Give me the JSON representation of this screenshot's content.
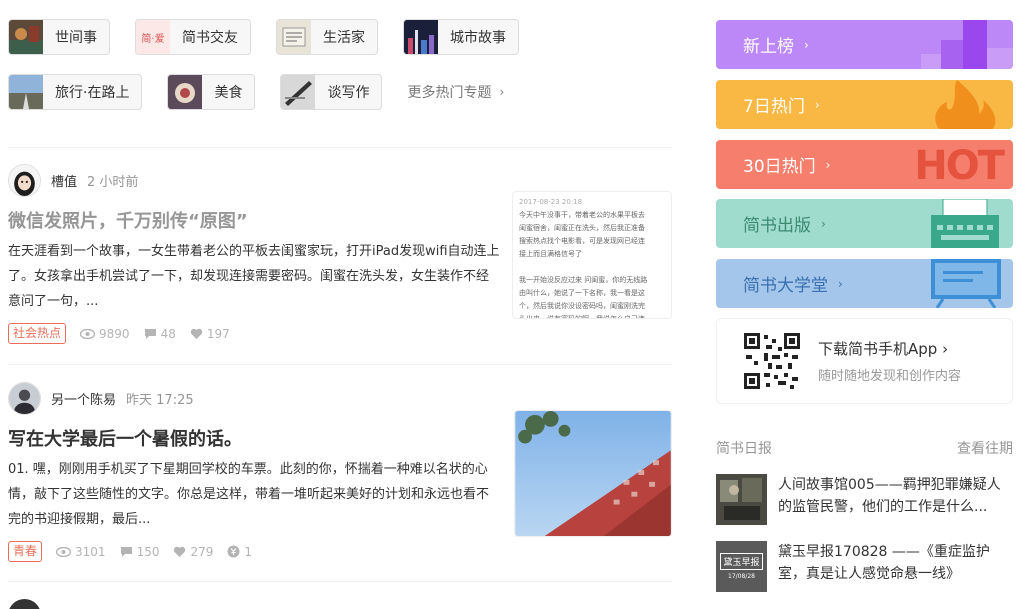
{
  "topics": {
    "row1": [
      {
        "label": "世间事"
      },
      {
        "label": "简书交友",
        "thumb_text": "简·爱"
      },
      {
        "label": "生活家"
      },
      {
        "label": "城市故事"
      }
    ],
    "row2": [
      {
        "label": "旅行·在路上"
      },
      {
        "label": "美食"
      },
      {
        "label": "谈写作"
      }
    ],
    "more_label": "更多热门专题"
  },
  "articles": [
    {
      "author": "槽值",
      "time": "2 小时前",
      "title": "微信发照片，千万别传“原图”",
      "abstract": "在天涯看到一个故事，一女生带着老公的平板去闺蜜家玩，打开iPad发现wifi自动连上了。女孩拿出手机尝试了一下，却发现连接需要密码。闺蜜在洗头发，女生装作不经意问了一句，...",
      "tag": "社会热点",
      "views": "9890",
      "comments": "48",
      "likes": "197",
      "thumb_lines": [
        "2017-08-23 20:18",
        "今天中午没事干，带着老公的水果平板去",
        "闺蜜宿舍，闺蜜正在洗头，然后我正准备",
        "搜索热点找个电影看，可是发现网已经连",
        "接上而且满格信号了",
        "",
        "我一开始没反应过来 问闺蜜，你的无线路",
        "由叫什么，她说了一下名称，我一看是这",
        "个，然后我说你没设密码吗，闺蜜刚洗完",
        "头出来，说有密码的啊，我说怎么自己连"
      ]
    },
    {
      "author": "另一个陈易",
      "time": "昨天 17:25",
      "title": "写在大学最后一个暑假的话。",
      "abstract": "01. 嘿，刚刚用手机买了下星期回学校的车票。此刻的你，怀揣着一种难以名状的心情，敲下了这些随性的文字。你总是这样，带着一堆听起来美好的计划和永远也看不完的书迎接假期，最后...",
      "tag": "青春",
      "views": "3101",
      "comments": "150",
      "likes": "279",
      "rewards": "1"
    }
  ],
  "boards": [
    {
      "label": "新上榜",
      "color": "#bc87f6"
    },
    {
      "label": "7日热门",
      "color": "#f9b843"
    },
    {
      "label": "30日热门",
      "color": "#f57f6c"
    },
    {
      "label": "简书出版",
      "color": "#9fdccd"
    },
    {
      "label": "简书大学堂",
      "color": "#a4c6ea"
    }
  ],
  "board_hot_text": "HOT",
  "app": {
    "title": "下载简书手机App",
    "subtitle": "随时随地发现和创作内容"
  },
  "daily": {
    "title": "简书日报",
    "more": "查看往期",
    "items": [
      {
        "text": "人间故事馆005——羁押犯罪嫌疑人的监管民警，他们的工作是什么..."
      },
      {
        "text": "黛玉早报170828 ——《重症监护室，真是让人感觉命悬一线》",
        "thumb_text": "黛玉早报",
        "thumb_date": "17/08/28"
      }
    ]
  }
}
